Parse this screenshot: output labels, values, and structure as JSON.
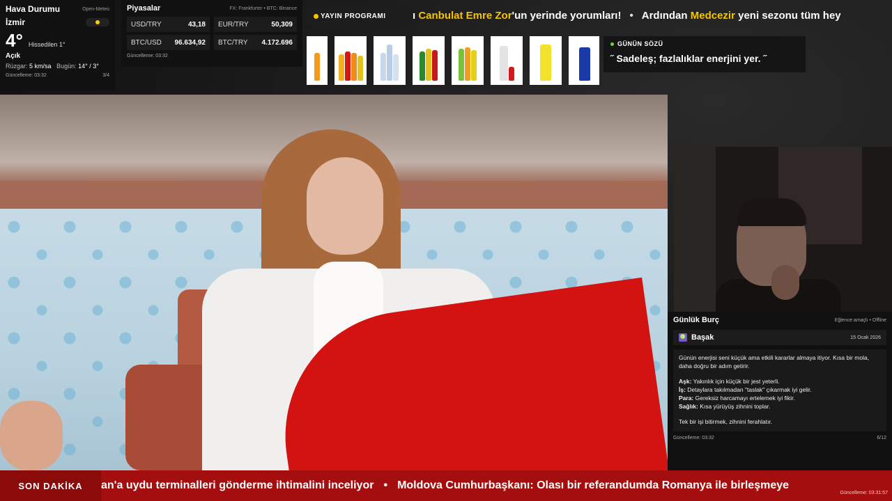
{
  "weather": {
    "title": "Hava Durumu",
    "source": "Open-Meteo",
    "city": "İzmir",
    "temp": "4°",
    "feels": "Hissedilen 1°",
    "condition": "Açık",
    "wind_label": "Rüzgar:",
    "wind_value": "5 km/sa",
    "today_label": "Bugün:",
    "today_value": "14° / 3°",
    "updated": "Güncelleme: 03:32",
    "page": "3/4",
    "sun_color": "#f5d000"
  },
  "markets": {
    "title": "Piyasalar",
    "source": "FX: Frankfurter • BTC: Binance",
    "items": [
      {
        "label": "USD/TRY",
        "value": "43,18"
      },
      {
        "label": "EUR/TRY",
        "value": "50,309"
      },
      {
        "label": "BTC/USD",
        "value": "96.634,92"
      },
      {
        "label": "BTC/TRY",
        "value": "4.172.696"
      }
    ],
    "updated": "Güncelleme: 03:32"
  },
  "schedule": {
    "label": "YAYIN PROGRAMI",
    "t1_prefix": "ı ",
    "t1_hl": "Canbulat Emre Zor",
    "t1_suffix": "'un yerinde yorumları!",
    "separator": "•",
    "t2_prefix": "Ardından ",
    "t2_hl": "Medcezir",
    "t2_suffix": " yeni sezonu tüm hey",
    "accent": "#f5c400"
  },
  "quote": {
    "label": "GÜNÜN SÖZÜ",
    "text": "˝ Sadeleş; fazlalıklar enerjini yer. ˝"
  },
  "horoscope": {
    "title": "Günlük Burç",
    "status": "Eğlence amaçlı • Offline",
    "sign": "Başak",
    "date": "15 Ocak 2026",
    "intro": "Günün enerjisi seni küçük ama etkili kararlar almaya itiyor. Kısa bir mola, daha doğru bir adım getirir.",
    "love_k": "Aşk:",
    "love_v": " Yakınlık için küçük bir jest yeterli.",
    "work_k": "İş:",
    "work_v": " Detaylara takılmadan \"taslak\" çıkarmak iyi gelir.",
    "money_k": "Para:",
    "money_v": " Gereksiz harcamayı ertelemek iyi fikir.",
    "health_k": "Sağlık:",
    "health_v": " Kısa yürüyüş zihnini toplar.",
    "closing": "Tek bir işi bitirmek, zihnini ferahlatır.",
    "updated": "Güncelleme: 03:32",
    "page": "6/12"
  },
  "breaking": {
    "label": "SON DAKİKA",
    "t1": "an'a uydu terminalleri gönderme ihtimalini inceliyor",
    "separator": "•",
    "t2": "Moldova Cumhurbaşkanı: Olası bir referandumda Romanya ile birleşmeye",
    "updated": "Güncelleme: 03:31:57"
  }
}
